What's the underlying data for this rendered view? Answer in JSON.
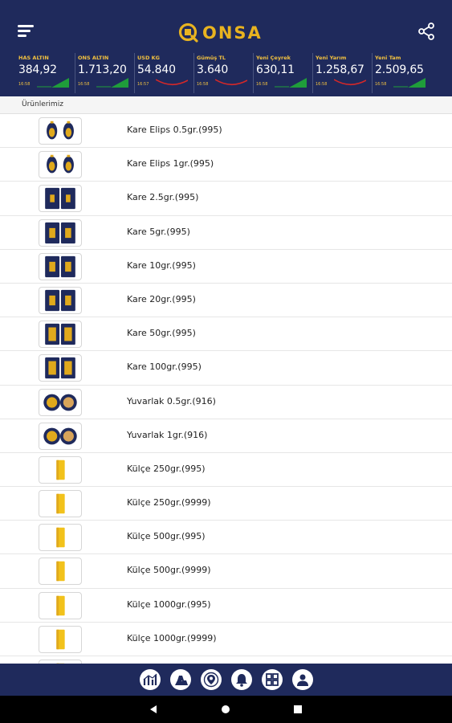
{
  "app": {
    "name": "ONSA",
    "colors": {
      "header_bg": "#1f2a5c",
      "gold": "#e8b320",
      "up": "#1f9d3a",
      "down": "#d62828"
    }
  },
  "header": {
    "menu_icon": "hamburger-menu-icon",
    "share_icon": "share-icon",
    "ticker": [
      {
        "label": "HAS ALTIN",
        "value": "384,92",
        "time": "16:58",
        "trend": "up"
      },
      {
        "label": "ONS ALTIN",
        "value": "1.713,20",
        "time": "16:58",
        "trend": "up"
      },
      {
        "label": "USD KG",
        "value": "54.840",
        "time": "16:57",
        "trend": "down"
      },
      {
        "label": "Gümüş TL",
        "value": "3.640",
        "time": "16:58",
        "trend": "down"
      },
      {
        "label": "Yeni Çeyrek",
        "value": "630,11",
        "time": "16:58",
        "trend": "up"
      },
      {
        "label": "Yeni Yarım",
        "value": "1.258,67",
        "time": "16:58",
        "trend": "down"
      },
      {
        "label": "Yeni Tam",
        "value": "2.509,65",
        "time": "16:58",
        "trend": "up"
      }
    ]
  },
  "section": {
    "title": "Ürünlerimiz"
  },
  "products": [
    {
      "name": "Kare Elips 0.5gr.(995)",
      "thumb": "elips"
    },
    {
      "name": "Kare Elips 1gr.(995)",
      "thumb": "elips"
    },
    {
      "name": "Kare 2.5gr.(995)",
      "thumb": "kare-small"
    },
    {
      "name": "Kare 5gr.(995)",
      "thumb": "kare"
    },
    {
      "name": "Kare 10gr.(995)",
      "thumb": "kare"
    },
    {
      "name": "Kare 20gr.(995)",
      "thumb": "kare"
    },
    {
      "name": "Kare 50gr.(995)",
      "thumb": "kare-big"
    },
    {
      "name": "Kare 100gr.(995)",
      "thumb": "kare-big"
    },
    {
      "name": "Yuvarlak 0.5gr.(916)",
      "thumb": "yuvarlak"
    },
    {
      "name": "Yuvarlak 1gr.(916)",
      "thumb": "yuvarlak"
    },
    {
      "name": "Külçe 250gr.(995)",
      "thumb": "kulce"
    },
    {
      "name": "Külçe 250gr.(9999)",
      "thumb": "kulce"
    },
    {
      "name": "Külçe 500gr.(995)",
      "thumb": "kulce"
    },
    {
      "name": "Külçe 500gr.(9999)",
      "thumb": "kulce"
    },
    {
      "name": "Külçe 1000gr.(995)",
      "thumb": "kulce"
    },
    {
      "name": "Külçe 1000gr.(9999)",
      "thumb": "kulce"
    },
    {
      "name": "",
      "thumb": "kulce"
    }
  ],
  "bottom_nav": [
    {
      "icon": "chart-icon"
    },
    {
      "icon": "gold-bars-icon"
    },
    {
      "icon": "location-pin-icon"
    },
    {
      "icon": "bell-icon"
    },
    {
      "icon": "grid-icon"
    },
    {
      "icon": "user-icon"
    }
  ],
  "system_bar": {
    "back": "back-icon",
    "home": "home-icon",
    "recent": "recent-apps-icon"
  }
}
